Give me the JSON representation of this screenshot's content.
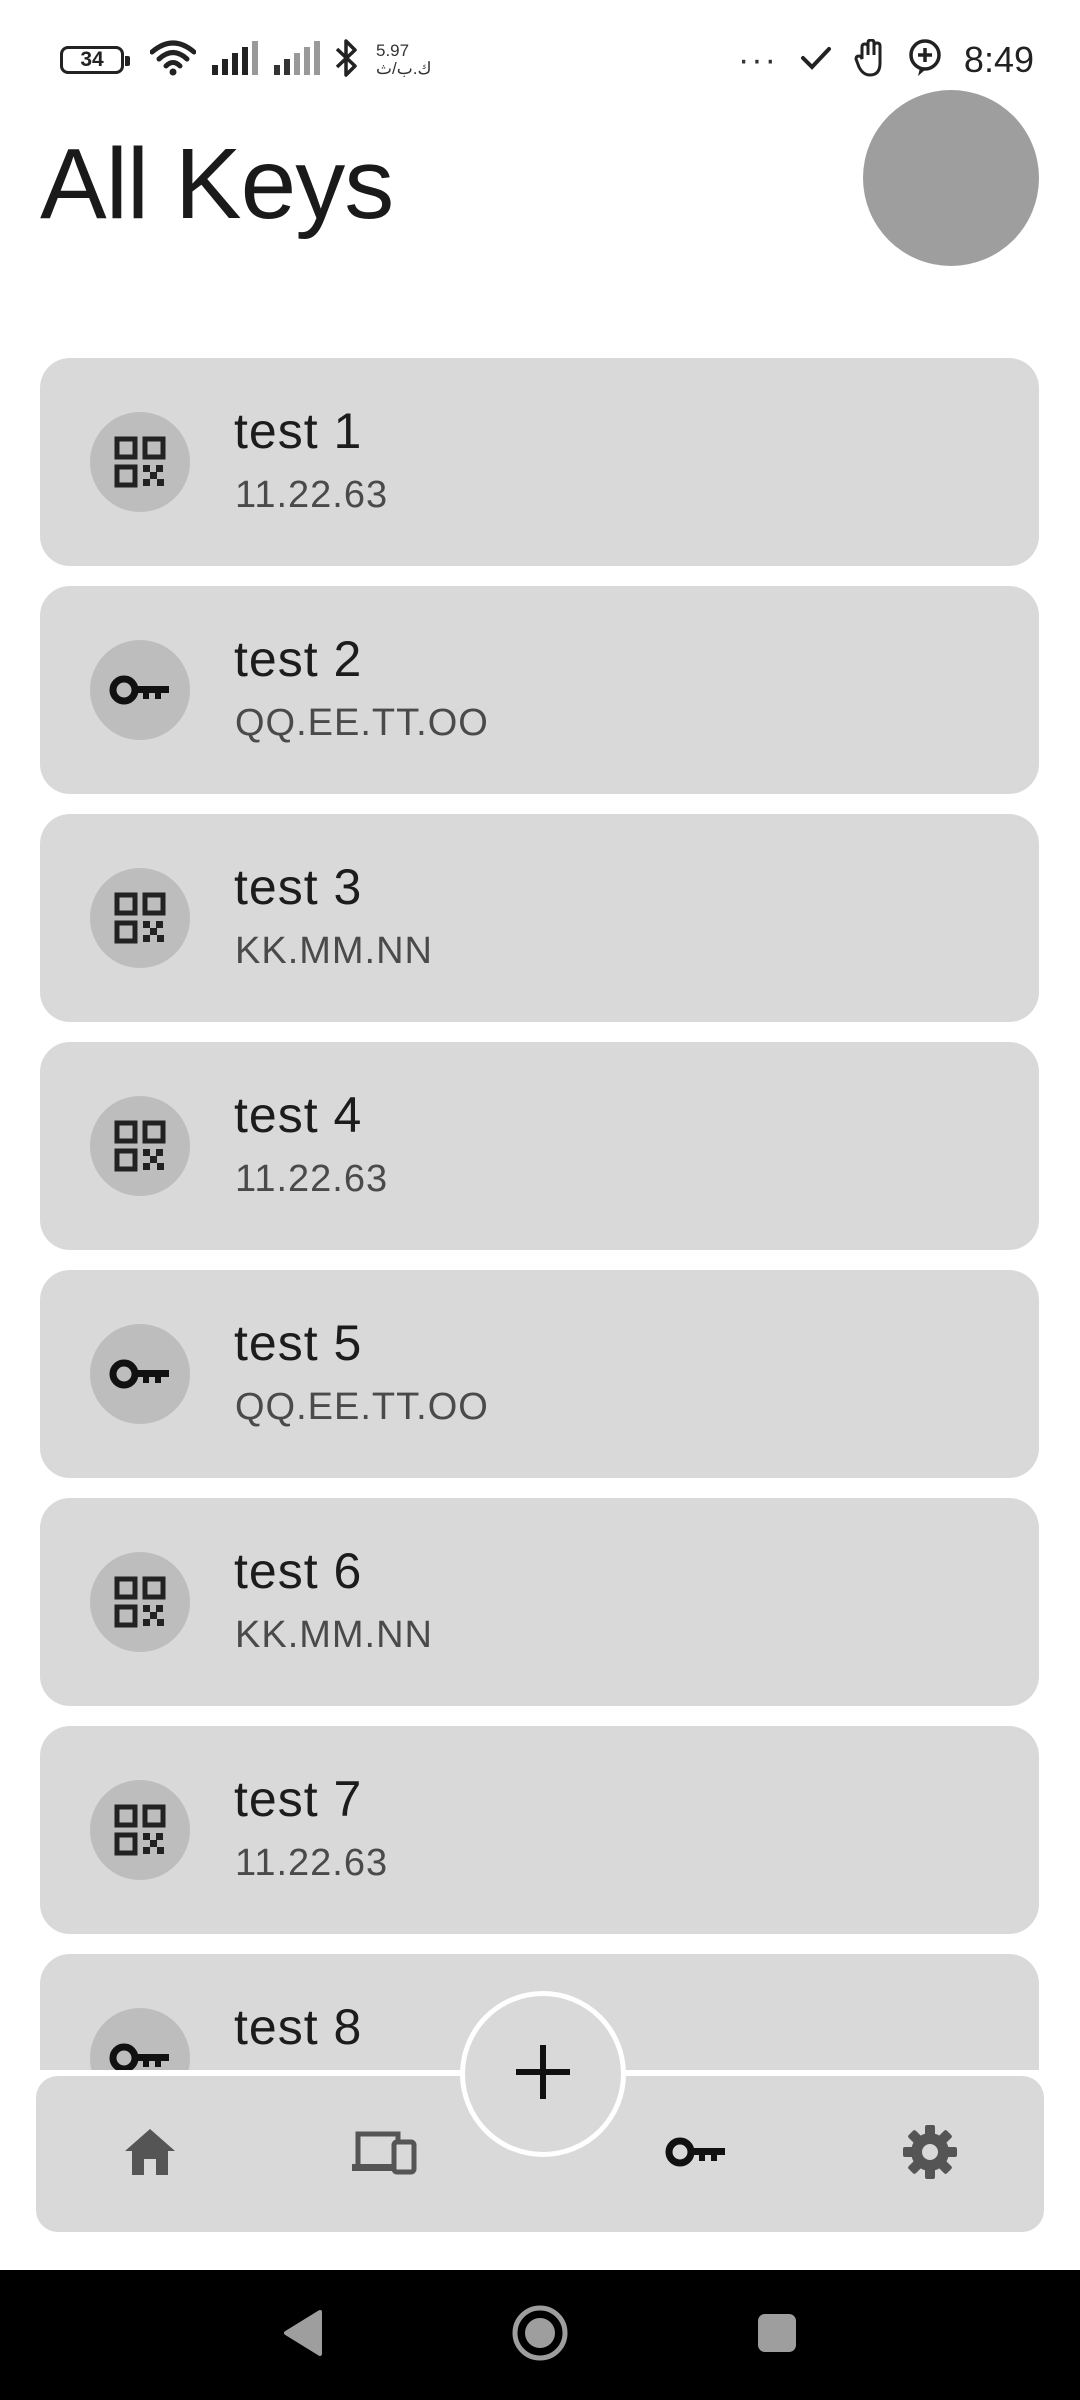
{
  "status_bar": {
    "battery": "34",
    "speed_value": "5.97",
    "speed_unit": "ك.ب/ث",
    "dots": "···",
    "time": "8:49"
  },
  "header": {
    "title": "All Keys"
  },
  "keys": [
    {
      "name": "test 1",
      "value": "11.22.63",
      "icon": "qr-code-icon"
    },
    {
      "name": "test 2",
      "value": "QQ.EE.TT.OO",
      "icon": "key-icon"
    },
    {
      "name": "test 3",
      "value": "KK.MM.NN",
      "icon": "qr-code-icon"
    },
    {
      "name": "test 4",
      "value": "11.22.63",
      "icon": "qr-code-icon"
    },
    {
      "name": "test 5",
      "value": "QQ.EE.TT.OO",
      "icon": "key-icon"
    },
    {
      "name": "test 6",
      "value": "KK.MM.NN",
      "icon": "qr-code-icon"
    },
    {
      "name": "test 7",
      "value": "11.22.63",
      "icon": "qr-code-icon"
    },
    {
      "name": "test 8",
      "value": "",
      "icon": "key-icon"
    }
  ],
  "bottom_nav": {
    "items": [
      "home-icon",
      "devices-icon",
      "key-icon",
      "gear-icon"
    ],
    "active": "key-icon"
  },
  "fab": {
    "icon": "plus-icon"
  },
  "colors": {
    "card": "#d9d9d9",
    "avatar": "#9e9e9e",
    "icon_circle": "#bdbdbd",
    "system_nav": "#000000"
  }
}
